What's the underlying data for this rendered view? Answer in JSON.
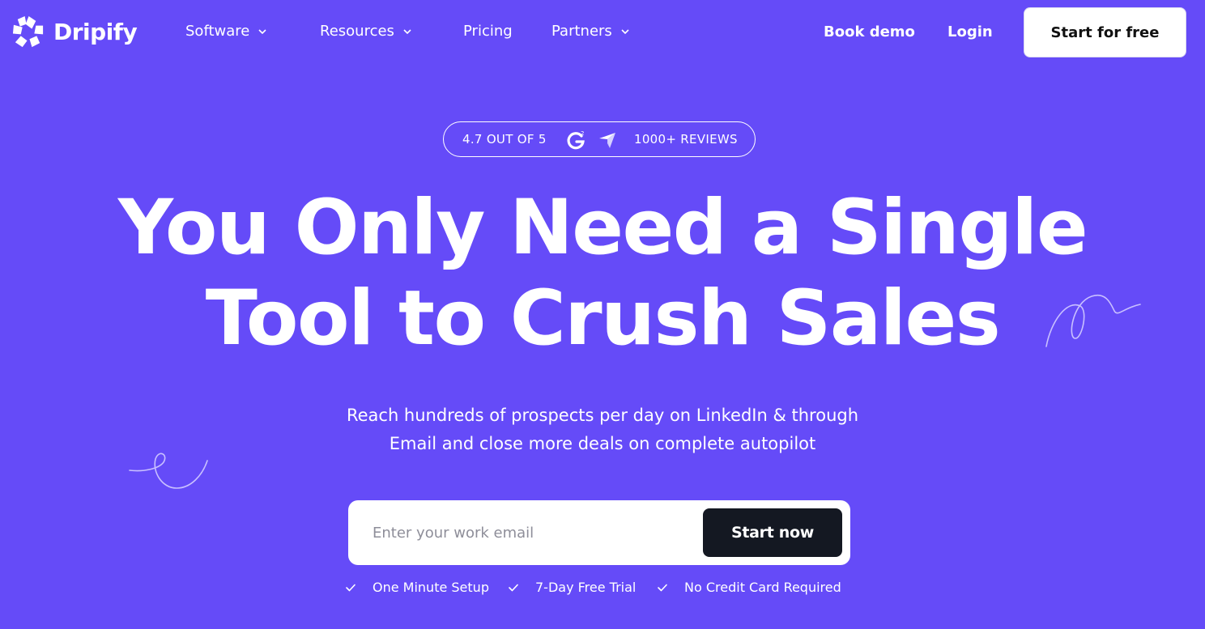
{
  "nav": {
    "brand": "Dripify",
    "items": [
      {
        "label": "Software",
        "has_dropdown": true
      },
      {
        "label": "Resources",
        "has_dropdown": true
      },
      {
        "label": "Pricing",
        "has_dropdown": false
      },
      {
        "label": "Partners",
        "has_dropdown": true
      }
    ],
    "book_demo": "Book demo",
    "login": "Login",
    "cta": "Start for free"
  },
  "rating": {
    "score": "4.7 OUT OF 5",
    "reviews": "1000+ REVIEWS"
  },
  "hero": {
    "title_line1": "You Only Need a Single",
    "title_line2": "Tool to Crush Sales",
    "subtitle_line1": "Reach hundreds of prospects per day on LinkedIn & through",
    "subtitle_line2": "Email and close more deals on complete autopilot"
  },
  "form": {
    "email_placeholder": "Enter your work email",
    "email_value": "",
    "submit": "Start now"
  },
  "features": [
    "One Minute Setup",
    "7-Day Free Trial",
    "No Credit Card Required"
  ],
  "colors": {
    "background": "#654bf8",
    "button_dark": "#141822",
    "text": "#ffffff"
  }
}
